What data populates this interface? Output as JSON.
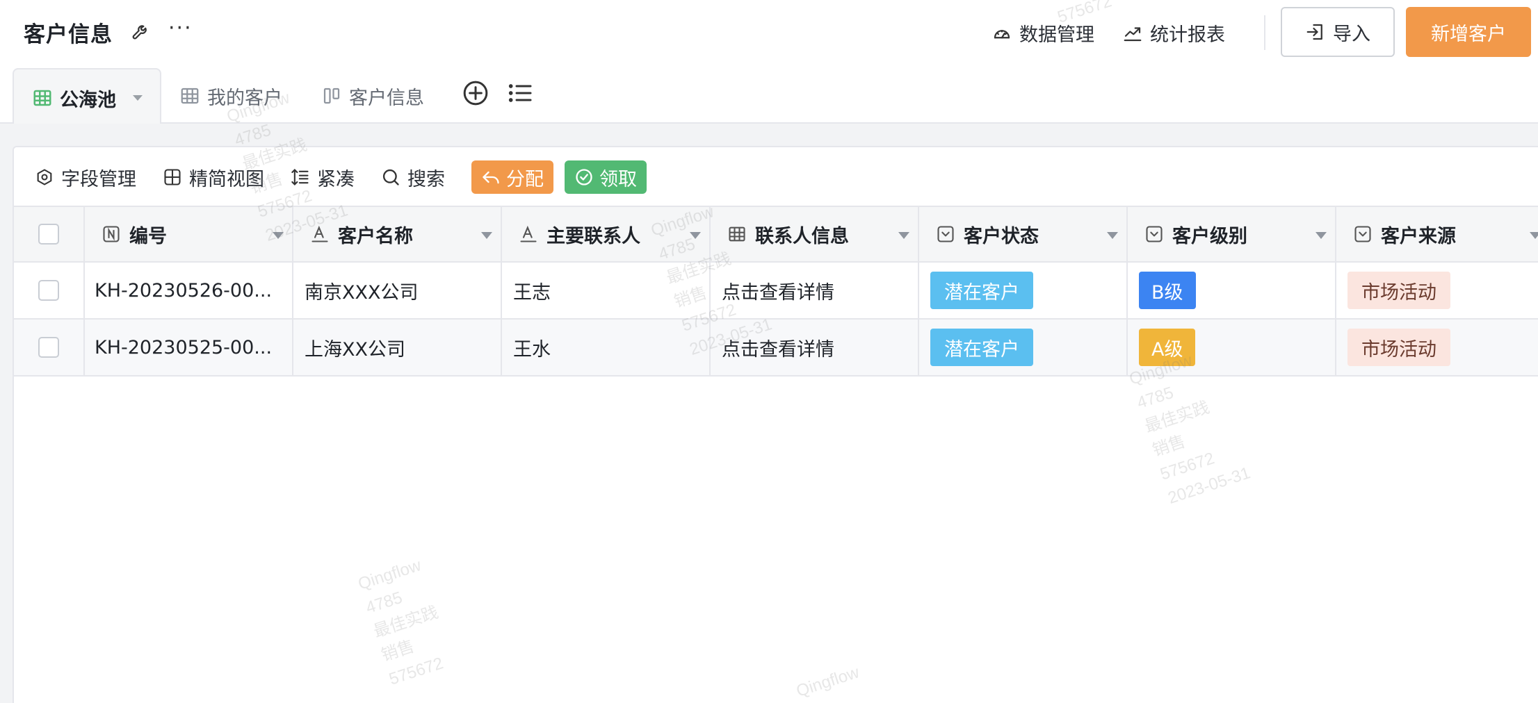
{
  "header": {
    "title": "客户信息",
    "links": [
      {
        "label": "数据管理",
        "icon": "dashboard-icon"
      },
      {
        "label": "统计报表",
        "icon": "trend-chart-icon"
      }
    ],
    "import_label": "导入",
    "new_label": "新增客户"
  },
  "tabs": [
    {
      "label": "公海池",
      "icon": "table-grid-icon",
      "active": true
    },
    {
      "label": "我的客户",
      "icon": "table-grid-icon",
      "active": false
    },
    {
      "label": "客户信息",
      "icon": "kanban-icon",
      "active": false
    }
  ],
  "toolbar": {
    "field_manage": "字段管理",
    "simple_view": "精简视图",
    "compact": "紧凑",
    "search": "搜索",
    "assign": "分配",
    "claim": "领取"
  },
  "table": {
    "columns": [
      {
        "label": "编号",
        "icon": "number-field-icon"
      },
      {
        "label": "客户名称",
        "icon": "text-field-icon"
      },
      {
        "label": "主要联系人",
        "icon": "text-field-icon"
      },
      {
        "label": "联系人信息",
        "icon": "table-grid-icon"
      },
      {
        "label": "客户状态",
        "icon": "select-field-icon"
      },
      {
        "label": "客户级别",
        "icon": "select-field-icon"
      },
      {
        "label": "客户来源",
        "icon": "select-field-icon"
      }
    ],
    "rows": [
      {
        "id": "KH-20230526-00...",
        "name": "南京XXX公司",
        "contact": "王志",
        "contact_info": "点击查看详情",
        "status": "潜在客户",
        "level": "B级",
        "source": "市场活动"
      },
      {
        "id": "KH-20230525-00...",
        "name": "上海XX公司",
        "contact": "王水",
        "contact_info": "点击查看详情",
        "status": "潜在客户",
        "level": "A级",
        "source": "市场活动"
      }
    ]
  },
  "watermark": {
    "brand": "Qingflow",
    "code": "4785",
    "team": "最佳实践",
    "dept": "销售",
    "user": "575672",
    "date": "2023-05-31"
  },
  "colors": {
    "accent_orange": "#f2994a",
    "claim_green": "#52b973",
    "status_blue": "#5bbff0",
    "level_b": "#3c84f2",
    "level_a": "#f0b53a",
    "source_pink": "#fbe5df"
  }
}
